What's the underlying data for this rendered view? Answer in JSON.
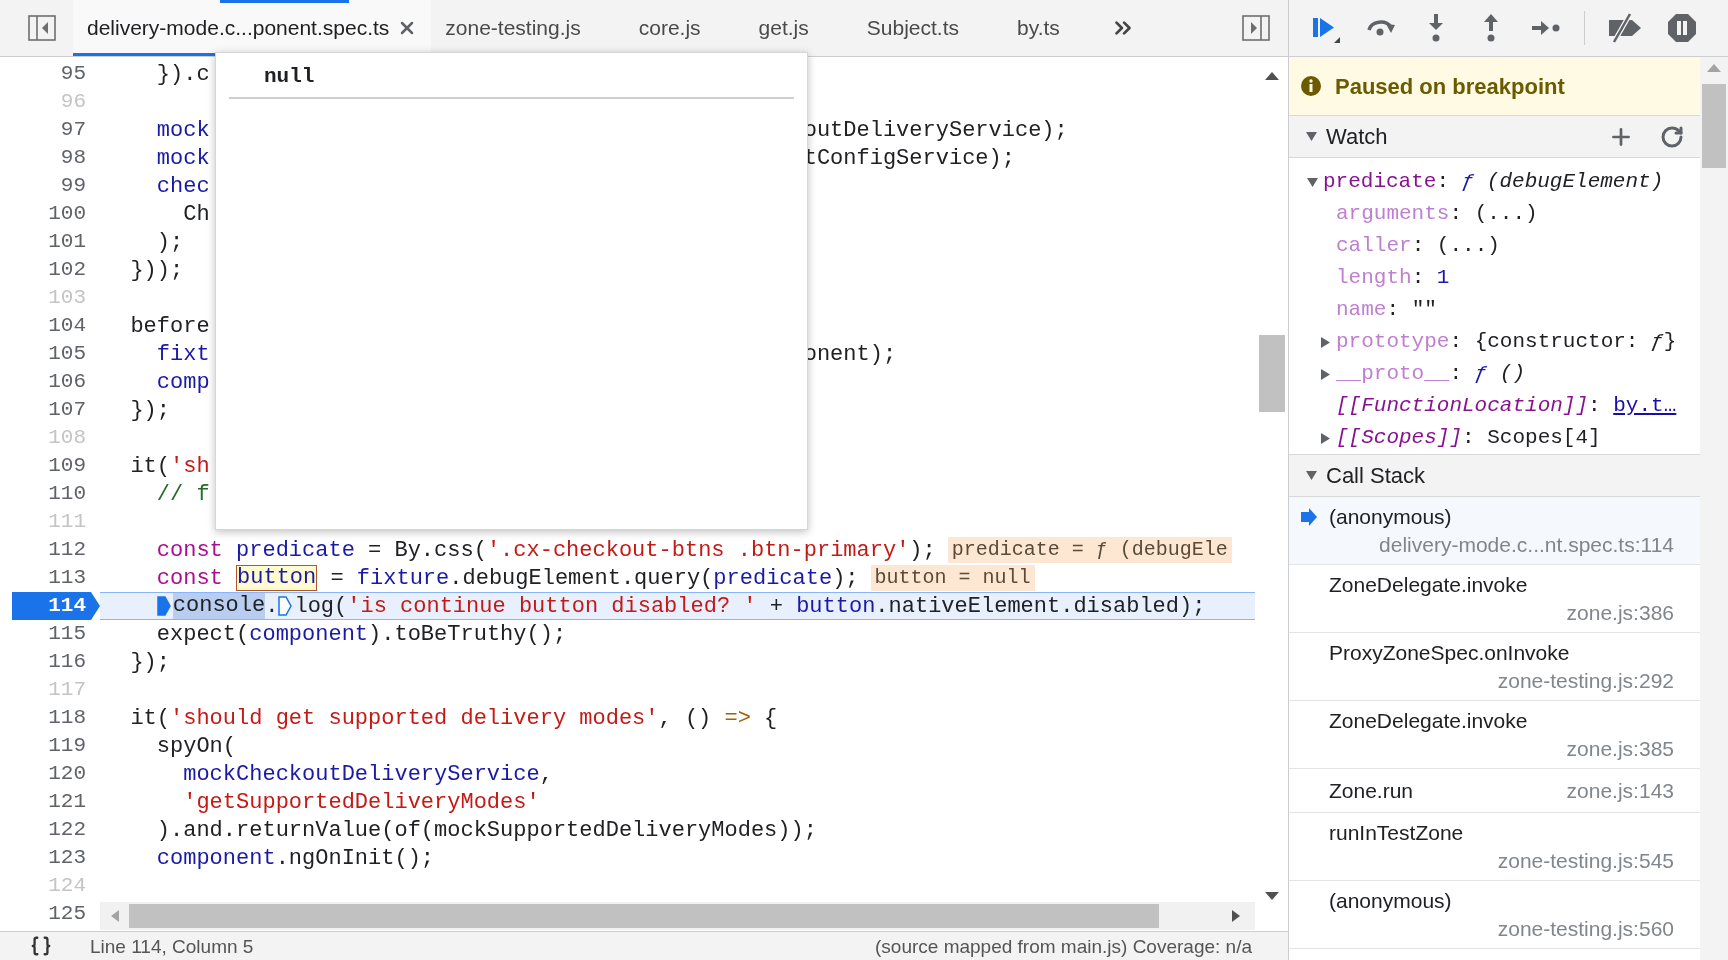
{
  "editor_tabs": [
    {
      "label": "delivery-mode.c...ponent.spec.ts",
      "selected": true,
      "closable": true
    },
    {
      "label": "zone-testing.js",
      "selected": false,
      "closable": false
    },
    {
      "label": "core.js",
      "selected": false,
      "closable": false
    },
    {
      "label": "get.js",
      "selected": false,
      "closable": false
    },
    {
      "label": "Subject.ts",
      "selected": false,
      "closable": false
    },
    {
      "label": "by.ts",
      "selected": false,
      "closable": false
    }
  ],
  "popover": {
    "value": "null"
  },
  "code_lines": [
    {
      "number": "95",
      "muted": false,
      "current": false,
      "tokens": [
        {
          "kind": "plain",
          "text": "    }).c"
        }
      ]
    },
    {
      "number": "96",
      "muted": true,
      "current": false
    },
    {
      "number": "97",
      "muted": false,
      "current": false,
      "tokens": [
        {
          "kind": "def",
          "text": "    mock"
        }
      ],
      "right_tokens": [
        {
          "kind": "plain",
          "text": "outDeliveryService);"
        }
      ]
    },
    {
      "number": "98",
      "muted": false,
      "current": false,
      "tokens": [
        {
          "kind": "def",
          "text": "    mock"
        }
      ],
      "right_tokens": [
        {
          "kind": "plain",
          "text": "tConfigService);"
        }
      ]
    },
    {
      "number": "99",
      "muted": false,
      "current": false,
      "tokens": [
        {
          "kind": "def",
          "text": "    chec"
        }
      ]
    },
    {
      "number": "100",
      "muted": false,
      "current": false,
      "tokens": [
        {
          "kind": "plain",
          "text": "      Ch"
        }
      ]
    },
    {
      "number": "101",
      "muted": false,
      "current": false,
      "tokens": [
        {
          "kind": "plain",
          "text": "    );"
        }
      ]
    },
    {
      "number": "102",
      "muted": false,
      "current": false,
      "tokens": [
        {
          "kind": "plain",
          "text": "  }));"
        }
      ]
    },
    {
      "number": "103",
      "muted": true,
      "current": false
    },
    {
      "number": "104",
      "muted": false,
      "current": false,
      "tokens": [
        {
          "kind": "plain",
          "text": "  before"
        }
      ]
    },
    {
      "number": "105",
      "muted": false,
      "current": false,
      "tokens": [
        {
          "kind": "def",
          "text": "    fixt"
        }
      ],
      "right_tokens": [
        {
          "kind": "plain",
          "text": "onent);"
        }
      ]
    },
    {
      "number": "106",
      "muted": false,
      "current": false,
      "tokens": [
        {
          "kind": "def",
          "text": "    comp"
        }
      ]
    },
    {
      "number": "107",
      "muted": false,
      "current": false,
      "tokens": [
        {
          "kind": "plain",
          "text": "  });"
        }
      ]
    },
    {
      "number": "108",
      "muted": true,
      "current": false
    },
    {
      "number": "109",
      "muted": false,
      "current": false,
      "tokens": [
        {
          "kind": "plain",
          "text": "  it("
        },
        {
          "kind": "string",
          "text": "'sh"
        }
      ]
    },
    {
      "number": "110",
      "muted": false,
      "current": false,
      "tokens": [
        {
          "kind": "comment",
          "text": "    // f"
        }
      ]
    },
    {
      "number": "111",
      "muted": true,
      "current": false
    },
    {
      "number": "112",
      "muted": false,
      "current": false,
      "tokens": [
        {
          "kind": "keyword",
          "text": "    const "
        },
        {
          "kind": "def",
          "text": "predicate"
        },
        {
          "kind": "plain",
          "text": " = By.css("
        },
        {
          "kind": "string",
          "text": "'.cx-checkout-btns .btn-primary'"
        },
        {
          "kind": "plain",
          "text": ");"
        }
      ],
      "inline_value": "predicate = ƒ (debugEle"
    },
    {
      "number": "113",
      "muted": false,
      "current": false,
      "tokens": [
        {
          "kind": "keyword",
          "text": "    const "
        },
        {
          "kind": "hovered",
          "text": "button"
        },
        {
          "kind": "plain",
          "text": " = "
        },
        {
          "kind": "def",
          "text": "fixture"
        },
        {
          "kind": "plain",
          "text": ".debugElement.query("
        },
        {
          "kind": "def",
          "text": "predicate"
        },
        {
          "kind": "plain",
          "text": ");"
        }
      ],
      "inline_value": "button = null"
    },
    {
      "number": "114",
      "muted": false,
      "current": true,
      "tokens": [
        {
          "kind": "breakpoint_marker",
          "enabled": true
        },
        {
          "kind": "selected",
          "text": "console"
        },
        {
          "kind": "plain",
          "text": "."
        },
        {
          "kind": "breakpoint_marker",
          "enabled": false
        },
        {
          "kind": "plain",
          "text": "log("
        },
        {
          "kind": "string",
          "text": "'is continue button disabled? '"
        },
        {
          "kind": "plain",
          "text": " + "
        },
        {
          "kind": "def",
          "text": "button"
        },
        {
          "kind": "plain",
          "text": ".nativeElement.disabled);"
        }
      ]
    },
    {
      "number": "115",
      "muted": false,
      "current": false,
      "tokens": [
        {
          "kind": "plain",
          "text": "    expect("
        },
        {
          "kind": "def",
          "text": "component"
        },
        {
          "kind": "plain",
          "text": ").toBeTruthy();"
        }
      ]
    },
    {
      "number": "116",
      "muted": false,
      "current": false,
      "tokens": [
        {
          "kind": "plain",
          "text": "  });"
        }
      ]
    },
    {
      "number": "117",
      "muted": true,
      "current": false
    },
    {
      "number": "118",
      "muted": false,
      "current": false,
      "tokens": [
        {
          "kind": "plain",
          "text": "  it("
        },
        {
          "kind": "string",
          "text": "'should get supported delivery modes'"
        },
        {
          "kind": "plain",
          "text": ", () "
        },
        {
          "kind": "arrow",
          "text": "=>"
        },
        {
          "kind": "plain",
          "text": " {"
        }
      ]
    },
    {
      "number": "119",
      "muted": false,
      "current": false,
      "tokens": [
        {
          "kind": "plain",
          "text": "    spyOn("
        }
      ]
    },
    {
      "number": "120",
      "muted": false,
      "current": false,
      "tokens": [
        {
          "kind": "def",
          "text": "      mockCheckoutDeliveryService"
        },
        {
          "kind": "plain",
          "text": ","
        }
      ]
    },
    {
      "number": "121",
      "muted": false,
      "current": false,
      "tokens": [
        {
          "kind": "string",
          "text": "      'getSupportedDeliveryModes'"
        }
      ]
    },
    {
      "number": "122",
      "muted": false,
      "current": false,
      "tokens": [
        {
          "kind": "plain",
          "text": "    ).and.returnValue(of(mockSupportedDeliveryModes));"
        }
      ]
    },
    {
      "number": "123",
      "muted": false,
      "current": false,
      "tokens": [
        {
          "kind": "def",
          "text": "    component"
        },
        {
          "kind": "plain",
          "text": ".ngOnInit();"
        }
      ]
    },
    {
      "number": "124",
      "muted": true,
      "current": false
    },
    {
      "number": "125",
      "muted": false,
      "current": false
    }
  ],
  "status_bar": {
    "position": "Line 114, Column 5",
    "source_info": "(source mapped from main.js) Coverage: n/a"
  },
  "paused_message": "Paused on breakpoint",
  "watch": {
    "title": "Watch",
    "expanded": true,
    "items": [
      {
        "kind": "node",
        "name": "predicate",
        "dimmed": false,
        "internal": false,
        "expanded": true,
        "value": [
          {
            "kind": "plain",
            "text": ": "
          },
          {
            "kind": "fn",
            "text": "ƒ"
          },
          {
            "kind": "italic",
            "text": " (debugElement)"
          }
        ],
        "children": [
          {
            "kind": "leaf",
            "name": "arguments",
            "dimmed": true,
            "internal": false,
            "value": [
              {
                "kind": "plain",
                "text": ": (...)"
              }
            ]
          },
          {
            "kind": "leaf",
            "name": "caller",
            "dimmed": true,
            "internal": false,
            "value": [
              {
                "kind": "plain",
                "text": ": (...)"
              }
            ]
          },
          {
            "kind": "leaf",
            "name": "length",
            "dimmed": true,
            "internal": false,
            "value": [
              {
                "kind": "plain",
                "text": ": "
              },
              {
                "kind": "number",
                "text": "1"
              }
            ]
          },
          {
            "kind": "leaf",
            "name": "name",
            "dimmed": true,
            "internal": false,
            "value": [
              {
                "kind": "plain",
                "text": ": \"\""
              }
            ]
          },
          {
            "kind": "node",
            "name": "prototype",
            "dimmed": true,
            "internal": false,
            "expanded": false,
            "value": [
              {
                "kind": "plain",
                "text": ": {constructor: "
              },
              {
                "kind": "italic",
                "text": "ƒ"
              },
              {
                "kind": "plain",
                "text": "}"
              }
            ]
          },
          {
            "kind": "node",
            "name": "__proto__",
            "dimmed": true,
            "internal": false,
            "expanded": false,
            "value": [
              {
                "kind": "plain",
                "text": ": "
              },
              {
                "kind": "fn",
                "text": "ƒ"
              },
              {
                "kind": "italic",
                "text": " ()"
              }
            ]
          },
          {
            "kind": "leaf",
            "name": "[[FunctionLocation]]",
            "dimmed": false,
            "internal": true,
            "value": [
              {
                "kind": "plain",
                "text": ": "
              },
              {
                "kind": "link",
                "text": "by.t…"
              }
            ]
          },
          {
            "kind": "node",
            "name": "[[Scopes]]",
            "dimmed": false,
            "internal": true,
            "expanded": false,
            "value": [
              {
                "kind": "plain",
                "text": ": Scopes[4]"
              }
            ]
          }
        ]
      }
    ]
  },
  "call_stack": {
    "title": "Call Stack",
    "expanded": true,
    "frames": [
      {
        "kind": "stacked",
        "function": "(anonymous)",
        "location": "delivery-mode.c...nt.spec.ts:114",
        "selected": true
      },
      {
        "kind": "stacked",
        "function": "ZoneDelegate.invoke",
        "location": "zone.js:386",
        "selected": false
      },
      {
        "kind": "stacked",
        "function": "ProxyZoneSpec.onInvoke",
        "location": "zone-testing.js:292",
        "selected": false
      },
      {
        "kind": "stacked",
        "function": "ZoneDelegate.invoke",
        "location": "zone.js:385",
        "selected": false
      },
      {
        "kind": "inline",
        "function": "Zone.run",
        "location": "zone.js:143",
        "selected": false
      },
      {
        "kind": "stacked",
        "function": "runInTestZone",
        "location": "zone-testing.js:545",
        "selected": false
      },
      {
        "kind": "stacked",
        "function": "(anonymous)",
        "location": "zone-testing.js:560",
        "selected": false
      }
    ]
  }
}
